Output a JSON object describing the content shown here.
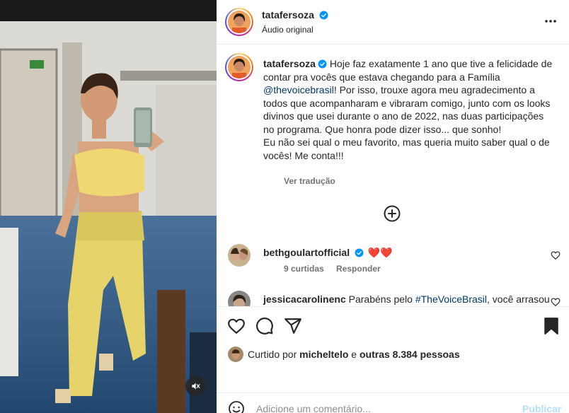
{
  "post": {
    "username": "tatafersoza",
    "audio": "Áudio original"
  },
  "caption": {
    "username": "tatafersoza",
    "text_1": "Hoje faz exatamente 1 ano que tive a felicidade de contar pra vocês que estava chegando para a Família",
    "mention": "@thevoicebrasil",
    "text_2": "! Por isso, trouxe agora meu agradecimento a todos que acompanharam e vibraram comigo, junto com os looks divinos que usei durante o ano de 2022, nas duas participações no programa. Que honra pode dizer isso... que sonho!",
    "text_3": "Eu não sei qual o meu favorito, mas queria muito saber qual o de vocês! Me conta!!!",
    "translate": "Ver tradução"
  },
  "comments": [
    {
      "username": "bethgoulartofficial",
      "text": "❤️❤️",
      "likes": "9 curtidas",
      "reply": "Responder"
    },
    {
      "username": "jessicacarolinenc",
      "text_prefix": "Parabéns pelo ",
      "hashtag": "#TheVoiceBrasil",
      "text_suffix": ", você arrasou"
    }
  ],
  "likes_line": {
    "prefix": "Curtido por ",
    "user": "micheltelo",
    "middle": " e ",
    "others": "outras 8.384 pessoas"
  },
  "add_comment": {
    "placeholder": "Adicione um comentário...",
    "post_label": "Publicar"
  },
  "colors": {
    "verified": "#0095f6",
    "link": "#00376b",
    "heart": "#ed1c24",
    "post_disabled": "#b2dffc"
  }
}
